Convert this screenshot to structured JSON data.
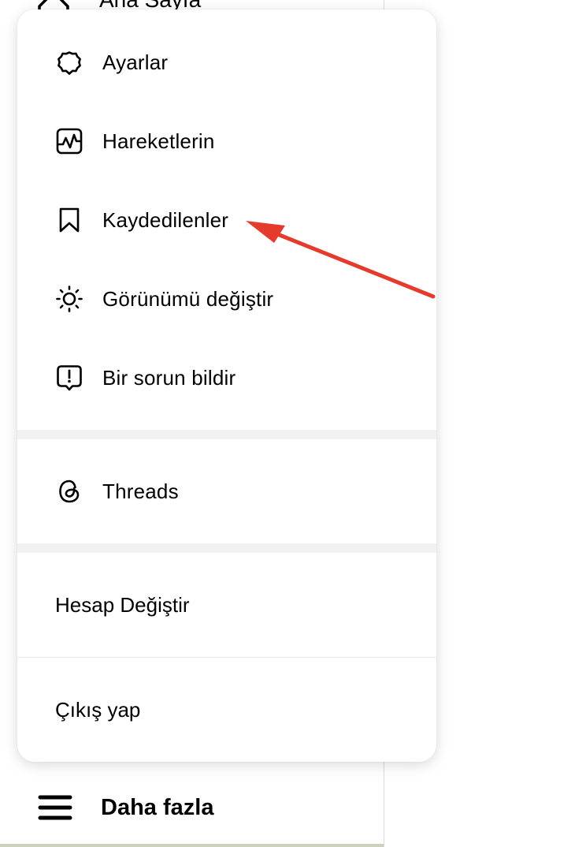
{
  "background": {
    "home_label": "Ana Sayfa"
  },
  "menu": {
    "items": [
      {
        "label": "Ayarlar",
        "icon": "settings-gear-icon"
      },
      {
        "label": "Hareketlerin",
        "icon": "activity-chart-icon"
      },
      {
        "label": "Kaydedilenler",
        "icon": "bookmark-icon"
      },
      {
        "label": "Görünümü değiştir",
        "icon": "sun-appearance-icon"
      },
      {
        "label": "Bir sorun bildir",
        "icon": "report-problem-icon"
      }
    ],
    "threads": {
      "label": "Threads",
      "icon": "threads-logo-icon"
    },
    "switch_account": "Hesap Değiştir",
    "logout": "Çıkış yap"
  },
  "sidebar": {
    "more_label": "Daha fazla",
    "more_icon": "hamburger-menu-icon"
  },
  "colors": {
    "annotation_arrow": "#e53b2c",
    "separator_band": "#f2f2f2",
    "divider": "#dbdbdb"
  }
}
